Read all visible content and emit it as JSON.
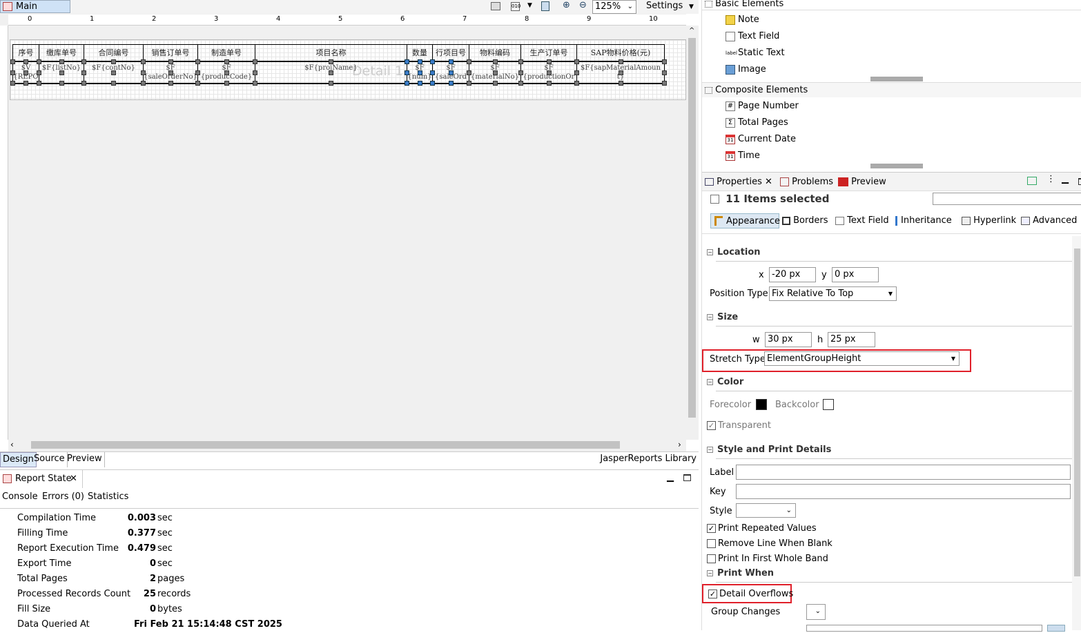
{
  "editor": {
    "main_tab": "Main Report",
    "zoom": "125%",
    "settings_label": "Settings",
    "ruler_ticks": [
      "0",
      "1",
      "2",
      "3",
      "4",
      "5",
      "6",
      "7",
      "8",
      "9",
      "10"
    ],
    "band_label": "Detail 1",
    "headers": [
      "序号",
      "缴库单号",
      "合同编号",
      "销售订单号",
      "制造单号",
      "项目名称",
      "数量",
      "行项目号",
      "物料编码",
      "生产订单号",
      "SAP物料价格(元)"
    ],
    "fields": [
      "$V\n{REPOR",
      "$F{listNo}",
      "$F{contNo}",
      "$F\n{saleOrderNo}",
      "$F\n{producCode}",
      "$F{projName}",
      "$F\n{num}",
      "$F\n{saleOrd",
      "$F\n{materialNo}",
      "$F\n{productionOrd",
      "$F{sapMaterialAmount}"
    ],
    "bottom_tabs": [
      "Design",
      "Source",
      "Preview"
    ],
    "library_label": "JasperReports Library"
  },
  "report_state": {
    "title": "Report State",
    "tabs": [
      "Console",
      "Errors (0)",
      "Statistics"
    ],
    "stats": [
      {
        "label": "Compilation Time",
        "value": "0.003",
        "unit": "sec"
      },
      {
        "label": "Filling Time",
        "value": "0.377",
        "unit": "sec"
      },
      {
        "label": "Report Execution Time",
        "value": "0.479",
        "unit": "sec"
      },
      {
        "label": "Export Time",
        "value": "0",
        "unit": "sec"
      },
      {
        "label": "Total Pages",
        "value": "2",
        "unit": "pages"
      },
      {
        "label": "Processed Records Count",
        "value": "25",
        "unit": "records"
      },
      {
        "label": "Fill Size",
        "value": "0",
        "unit": "bytes"
      },
      {
        "label": "Data Queried At",
        "value": "Fri Feb 21 15:14:48 CST 2025",
        "unit": ""
      }
    ]
  },
  "palette": {
    "basic_title": "Basic Elements",
    "basic_items": [
      "Note",
      "Text Field",
      "Static Text",
      "Image"
    ],
    "composite_title": "Composite Elements",
    "composite_items": [
      "Page Number",
      "Total Pages",
      "Current Date",
      "Time"
    ]
  },
  "properties": {
    "tabs": [
      "Properties",
      "Problems",
      "Preview"
    ],
    "selection_title": "11 Items selected",
    "sub_tabs": [
      "Appearance",
      "Borders",
      "Text Field",
      "Inheritance",
      "Hyperlink",
      "Advanced"
    ],
    "location": {
      "title": "Location",
      "x_label": "x",
      "x": "-20 px",
      "y_label": "y",
      "y": "0 px",
      "position_type_label": "Position Type",
      "position_type": "Fix Relative To Top"
    },
    "size": {
      "title": "Size",
      "w_label": "w",
      "w": "30 px",
      "h_label": "h",
      "h": "25 px",
      "stretch_type_label": "Stretch Type",
      "stretch_type": "ElementGroupHeight"
    },
    "color": {
      "title": "Color",
      "forecolor_label": "Forecolor",
      "forecolor": "#000000",
      "backcolor_label": "Backcolor",
      "backcolor": "#ffffff",
      "transparent_label": "Transparent"
    },
    "style_print": {
      "title": "Style and Print Details",
      "label_label": "Label",
      "key_label": "Key",
      "style_label": "Style",
      "print_repeated": "Print Repeated Values",
      "remove_line": "Remove Line When Blank",
      "print_first": "Print In First Whole Band"
    },
    "print_when": {
      "title": "Print When",
      "detail_overflows": "Detail Overflows",
      "group_changes": "Group Changes"
    }
  }
}
